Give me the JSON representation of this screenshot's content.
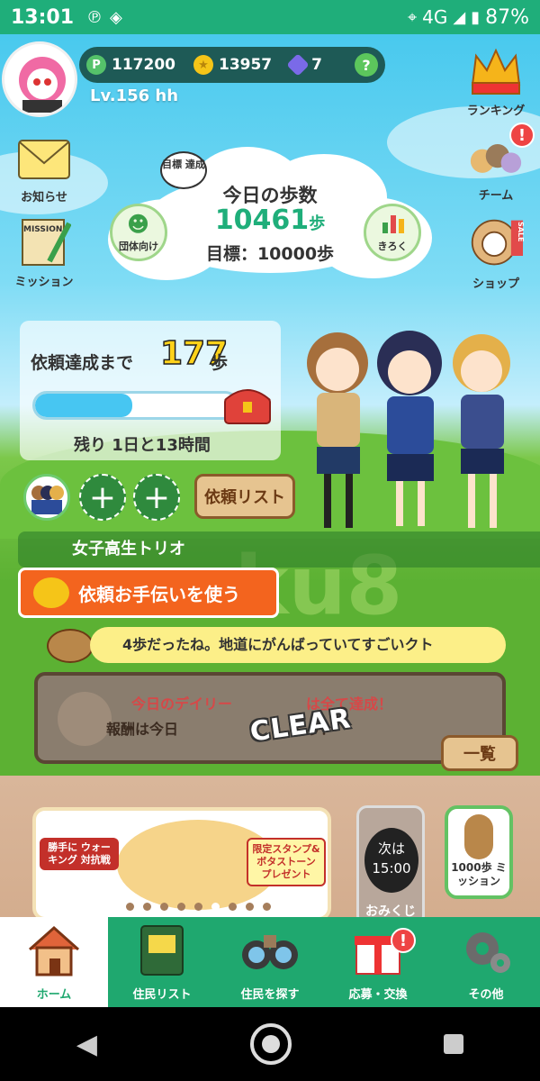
{
  "status_bar": {
    "time": "13:01",
    "network": "4G",
    "battery": "87%"
  },
  "header": {
    "points_label": "P",
    "points": "117200",
    "coins": "13957",
    "gems": "7",
    "help_label": "?",
    "level": "Lv.156 hh"
  },
  "side_left": {
    "notice_label": "お知らせ",
    "mission_label": "ミッション",
    "mission_stamp": "MISSION"
  },
  "side_right": {
    "ranking_label": "ランキング",
    "team_label": "チーム",
    "team_badge": "!",
    "shop_label": "ショップ",
    "shop_tag": "SALE"
  },
  "steps": {
    "goal_bubble": "目標 達成",
    "title": "今日の歩数",
    "count": "10461",
    "count_unit": "歩",
    "goal": "目標：10000歩",
    "group_label": "団体向け",
    "record_label": "きろく"
  },
  "request": {
    "label": "依頼達成まで",
    "remaining_steps": "177",
    "unit": "歩",
    "progress": 0.48,
    "time_left": "残り 1日と13時間",
    "list_button": "依頼リスト",
    "team_name": "女子高生トリオ",
    "help_button": "依頼お手伝いを使う",
    "add_slot_label": "+"
  },
  "message": "4歩だったね。地道にがんばっていてすごいクト",
  "daily": {
    "line1": "今日のデイリー",
    "line1_end": "は全て達成！",
    "line2": "報酬は今日",
    "line2_end": "う！",
    "stamp": "CLEAR",
    "list_button": "一覧"
  },
  "banner": {
    "left_tag": "勝手に ウォーキング 対抗戦",
    "right_tag": "限定スタンプ& ボタストーン プレゼント"
  },
  "omikuji": {
    "next": "次は",
    "time": "15:00",
    "label": "おみくじ"
  },
  "mission1000": {
    "label": "1000歩 ミッション"
  },
  "tabs": [
    {
      "label": "ホーム"
    },
    {
      "label": "住民リスト"
    },
    {
      "label": "住民を探す"
    },
    {
      "label": "応募・交換",
      "badge": "!"
    },
    {
      "label": "その他"
    }
  ]
}
